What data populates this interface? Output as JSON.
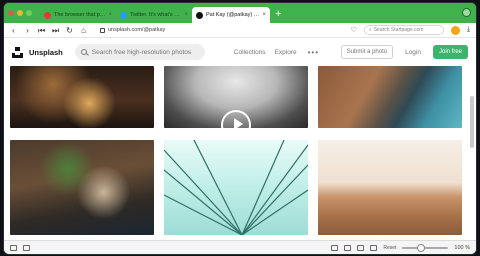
{
  "browser": {
    "tabs": [
      {
        "label": "The browser that puts you",
        "favicon_color": "#e53935",
        "active": false
      },
      {
        "label": "Twitter. It's what's happen",
        "favicon_color": "#1da1f2",
        "active": false
      },
      {
        "label": "Pat Kay (@patkay) | Unspl",
        "favicon_color": "#111111",
        "active": true
      }
    ],
    "new_tab_label": "+",
    "url": "unsplash.com/@patkay",
    "search_placeholder": "Search Startpage.com",
    "accent_color": "#3fb24b"
  },
  "site": {
    "brand": "Unsplash",
    "search_placeholder": "Search free high-resolution photos",
    "nav": [
      "Collections",
      "Explore"
    ],
    "more_label": "•••",
    "submit_label": "Submit a photo",
    "login_label": "Login",
    "join_label": "Join free",
    "join_color": "#3cb46e"
  },
  "photos": [
    {
      "subject": "night city lights aerial"
    },
    {
      "subject": "foggy mountain video"
    },
    {
      "subject": "coastal road aerial"
    },
    {
      "subject": "floating market boats"
    },
    {
      "subject": "bridge cables abstract"
    },
    {
      "subject": "desert dunes with person"
    }
  ],
  "status": {
    "reset_label": "Reset",
    "zoom": "100 %"
  }
}
